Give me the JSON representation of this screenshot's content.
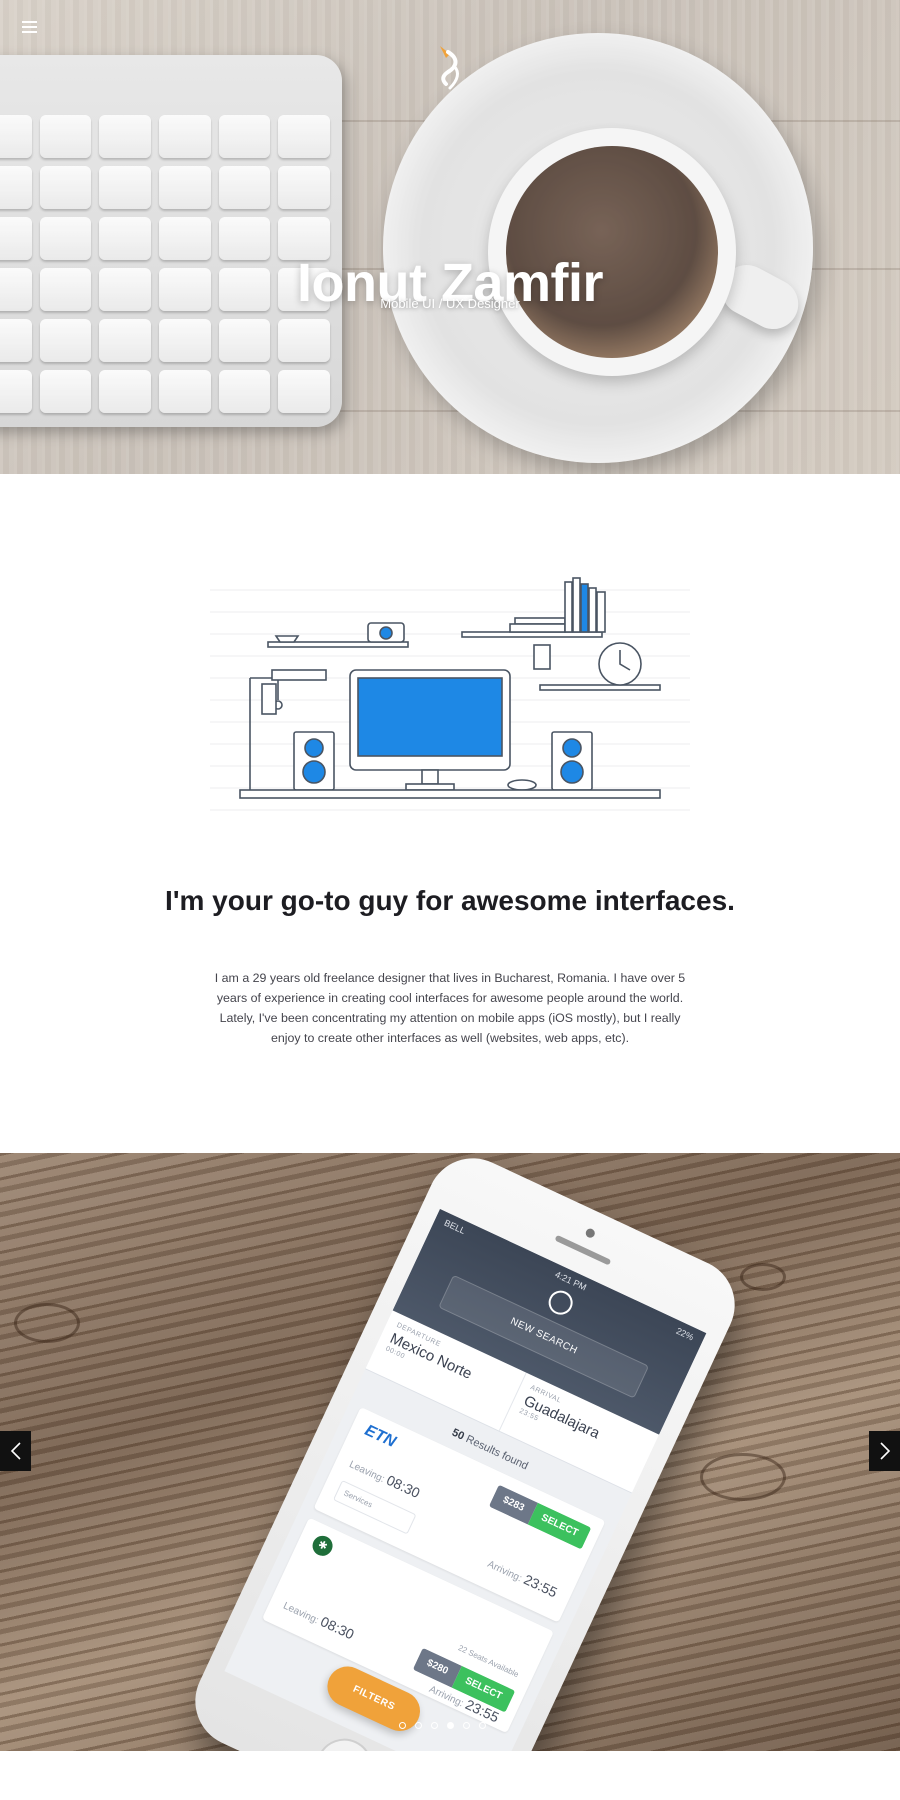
{
  "hero": {
    "name": "Ionut Zamfir",
    "role": "Mobile UI / UX Designer",
    "logo_colors": [
      "#f0a23a",
      "#ffffff"
    ]
  },
  "about": {
    "heading": "I'm your go-to guy for awesome interfaces.",
    "text": "I am a 29 years old freelance designer that lives in Bucharest, Romania. I have over 5 years of experience in creating cool interfaces for awesome people around the world. Lately, I've been concentrating my attention on mobile apps (iOS mostly), but I really enjoy to create other interfaces as well (websites, web apps, etc).",
    "illustration_accent": "#1e88e5"
  },
  "showcase": {
    "status_carrier": "BELL",
    "status_time": "4:21 PM",
    "status_battery": "22%",
    "search_label": "NEW SEARCH",
    "departure_caption": "DEPARTURE",
    "departure_city": "Mexico Norte",
    "departure_time_pill": "00:00",
    "arrival_caption": "ARRIVAL",
    "arrival_city": "Guadalajara",
    "arrival_time_pill": "23:55",
    "results_count": "50",
    "results_label": "Results found",
    "cards": [
      {
        "brand": "ETN",
        "price": "$283",
        "select_label": "SELECT",
        "leaving_label": "Leaving:",
        "leaving_time": "08:30",
        "arriving_label": "Arriving:",
        "arriving_time": "23:55",
        "services_label": "Services",
        "seats_label": ""
      },
      {
        "brand": "",
        "price": "$280",
        "select_label": "SELECT",
        "leaving_label": "Leaving:",
        "leaving_time": "08:30",
        "arriving_label": "Arriving:",
        "arriving_time": "23:55",
        "services_label": "",
        "seats_label": "22 Seats Available"
      }
    ],
    "filters_label": "FILTERS",
    "price_color": "#6d7788",
    "select_color": "#3cc15e",
    "filters_color": "#f0a23a"
  },
  "slider": {
    "prev_icon": "chevron-left-icon",
    "next_icon": "chevron-right-icon",
    "dot_count": 7,
    "active_dot": 4
  }
}
